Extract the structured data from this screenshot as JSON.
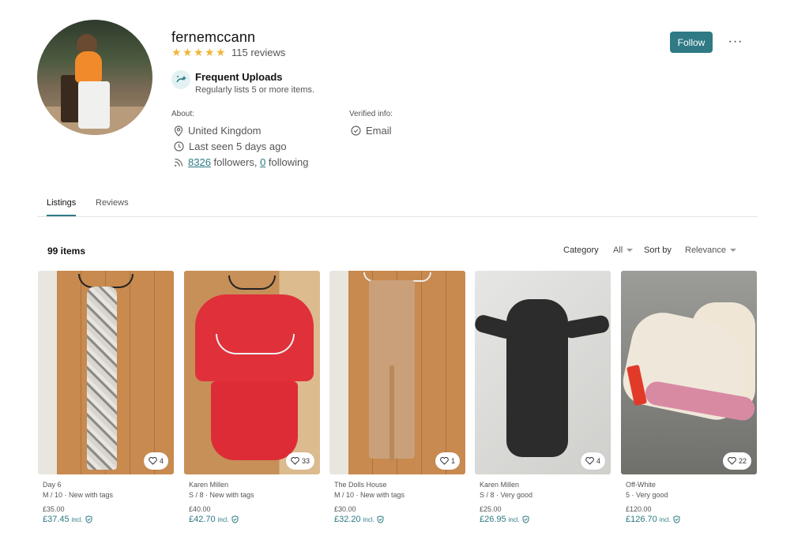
{
  "profile": {
    "username": "fernemccann",
    "rating_stars": 5,
    "reviews_label": "115 reviews",
    "badge": {
      "title": "Frequent Uploads",
      "subtitle": "Regularly lists 5 or more items."
    },
    "about_label": "About:",
    "location": "United Kingdom",
    "last_seen": "Last seen 5 days ago",
    "followers_count": "8326",
    "followers_text": " followers, ",
    "following_count": "0",
    "following_text": " following",
    "verified_label": "Verified info:",
    "verified_email": "Email",
    "follow_button": "Follow",
    "more_button": "···"
  },
  "tabs": [
    {
      "label": "Listings",
      "active": true
    },
    {
      "label": "Reviews",
      "active": false
    }
  ],
  "listing_toolbar": {
    "items_count": "99 items",
    "category_label": "Category",
    "category_value": "All",
    "sort_label": "Sort by",
    "sort_value": "Relevance"
  },
  "items": [
    {
      "brand": "Day 6",
      "meta": "M / 10 · New with tags",
      "price": "£35.00",
      "total": "£37.45",
      "incl": "incl.",
      "favorites": "4"
    },
    {
      "brand": "Karen Millen",
      "meta": "S / 8 · New with tags",
      "price": "£40.00",
      "total": "£42.70",
      "incl": "incl.",
      "favorites": "33"
    },
    {
      "brand": "The Dolls House",
      "meta": "M / 10 · New with tags",
      "price": "£30.00",
      "total": "£32.20",
      "incl": "incl.",
      "favorites": "1"
    },
    {
      "brand": "Karen Millen",
      "meta": "S / 8 · Very good",
      "price": "£25.00",
      "total": "£26.95",
      "incl": "incl.",
      "favorites": "4"
    },
    {
      "brand": "Off-White",
      "meta": "5 · Very good",
      "price": "£120.00",
      "total": "£126.70",
      "incl": "incl.",
      "favorites": "22"
    }
  ],
  "colors": {
    "accent": "#2f7a84",
    "star": "#f0b63b",
    "price_total": "#2b7a83"
  }
}
